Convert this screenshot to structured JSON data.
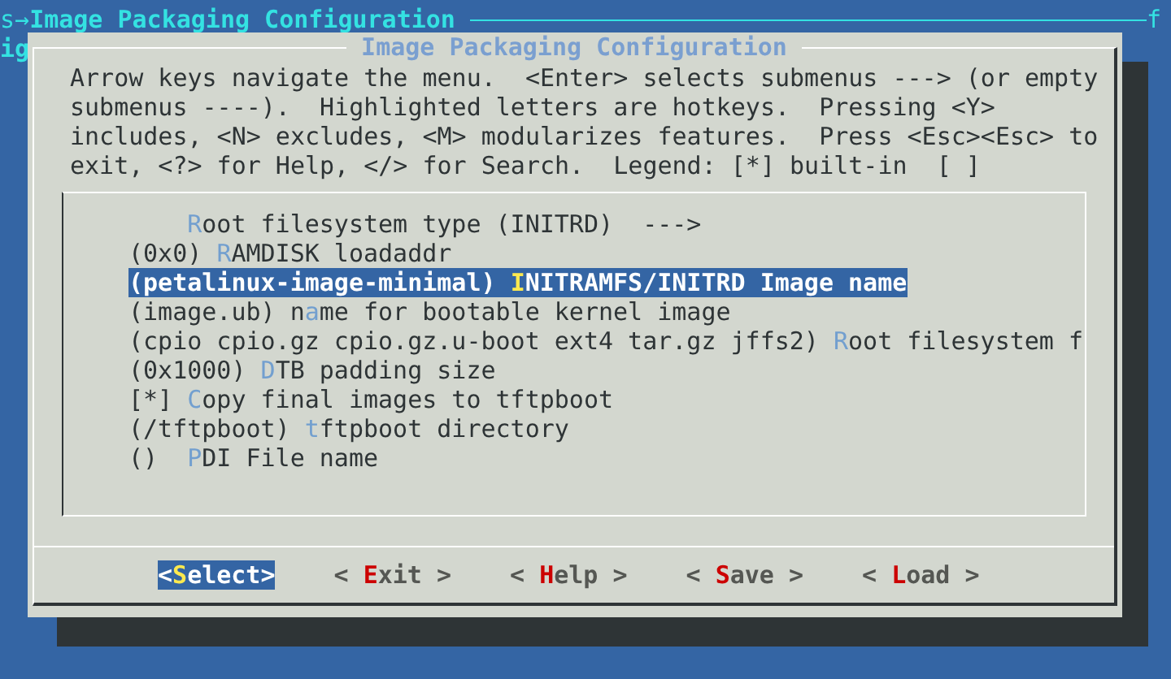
{
  "background": {
    "breadcrumb_prefix": "s",
    "breadcrumb_arrow": "→",
    "breadcrumb_title": "Image Packaging Configuration",
    "edge_letter": "f",
    "second_line": "ig"
  },
  "dialog": {
    "title": "Image Packaging Configuration",
    "help_text": "Arrow keys navigate the menu.  <Enter> selects submenus ---> (or empty submenus ----).  Highlighted letters are hotkeys.  Pressing <Y> includes, <N> excludes, <M> modularizes features.  Press <Esc><Esc> to exit, <?> for Help, </> for Search.  Legend: [*] built-in  [ ]",
    "items": [
      {
        "kind": "submenu",
        "hotkey": "R",
        "after": "oot filesystem type (INITRD)  --->",
        "selected": false
      },
      {
        "kind": "option",
        "before": "(0x0) ",
        "hotkey": "R",
        "after": "AMDISK loadaddr",
        "selected": false
      },
      {
        "kind": "option",
        "before": "(petalinux-image-minimal) ",
        "hotkey": "I",
        "after": "NITRAMFS/INITRD Image name",
        "selected": true
      },
      {
        "kind": "option",
        "before": "(image.ub) n",
        "hotkey": "a",
        "after": "me for bootable kernel image",
        "selected": false
      },
      {
        "kind": "option",
        "before": "(cpio cpio.gz cpio.gz.u-boot ext4 tar.gz jffs2) ",
        "hotkey": "R",
        "after": "oot filesystem f",
        "selected": false
      },
      {
        "kind": "option",
        "before": "(0x1000) ",
        "hotkey": "D",
        "after": "TB padding size",
        "selected": false
      },
      {
        "kind": "option",
        "before": "[*] ",
        "hotkey": "C",
        "after": "opy final images to tftpboot",
        "selected": false
      },
      {
        "kind": "option",
        "before": "(/tftpboot) ",
        "hotkey": "t",
        "after": "ftpboot directory",
        "selected": false
      },
      {
        "kind": "option",
        "before": "()  ",
        "hotkey": "P",
        "after": "DI File name",
        "selected": false
      }
    ],
    "buttons": [
      {
        "before": "<",
        "hotkey": "S",
        "after": "elect>",
        "selected": true
      },
      {
        "before": "< ",
        "hotkey": "E",
        "after": "xit >",
        "selected": false
      },
      {
        "before": "< ",
        "hotkey": "H",
        "after": "elp >",
        "selected": false
      },
      {
        "before": "< ",
        "hotkey": "S",
        "after": "ave >",
        "selected": false
      },
      {
        "before": "< ",
        "hotkey": "L",
        "after": "oad >",
        "selected": false
      }
    ]
  }
}
